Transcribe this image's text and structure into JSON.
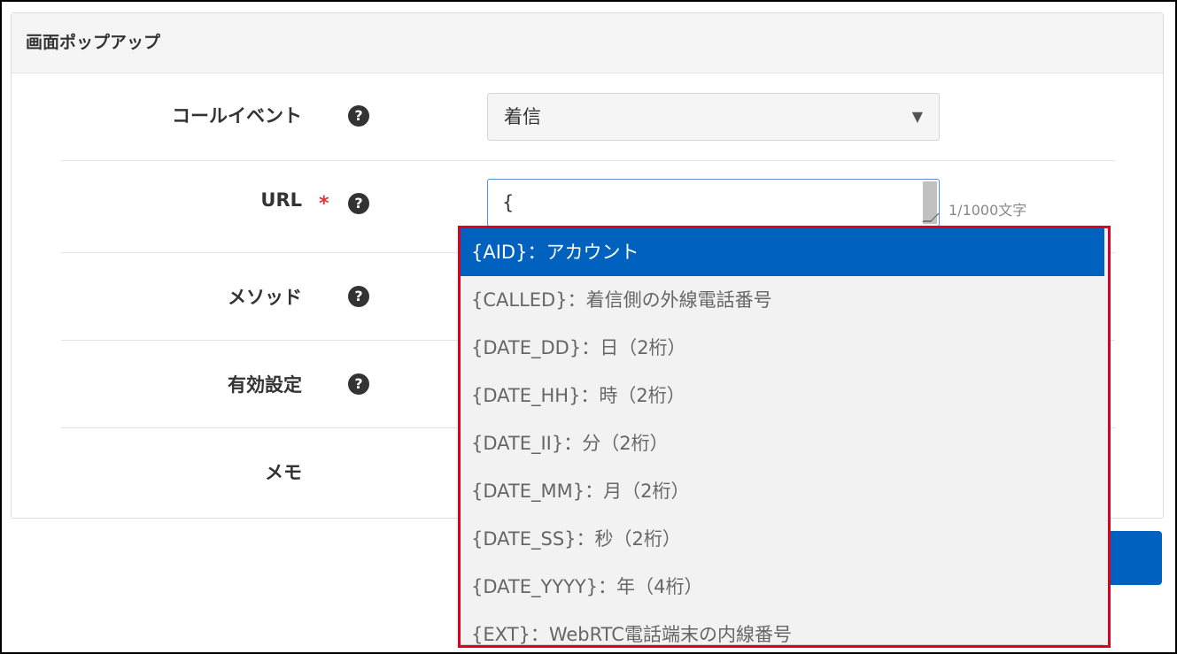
{
  "panel": {
    "title": "画面ポップアップ"
  },
  "fields": {
    "call_event": {
      "label": "コールイベント",
      "value": "着信"
    },
    "url": {
      "label": "URL",
      "required_mark": "*",
      "value": "{",
      "counter": "1/1000文字"
    },
    "method": {
      "label": "メソッド"
    },
    "enabled": {
      "label": "有効設定"
    },
    "memo": {
      "label": "メモ"
    }
  },
  "help_glyph": "?",
  "dropdown_caret": "▼",
  "autocomplete": {
    "items": [
      "{AID}：アカウント",
      "{CALLED}：着信側の外線電話番号",
      "{DATE_DD}：日（2桁）",
      "{DATE_HH}：時（2桁）",
      "{DATE_II}：分（2桁）",
      "{DATE_MM}：月（2桁）",
      "{DATE_SS}：秒（2桁）",
      "{DATE_YYYY}：年（4桁）",
      "{EXT}：WebRTC電話端末の内線番号"
    ],
    "selected_index": 0
  },
  "colors": {
    "accent": "#0061bf",
    "highlight_border": "#e0001b",
    "required": "#d9363e"
  }
}
